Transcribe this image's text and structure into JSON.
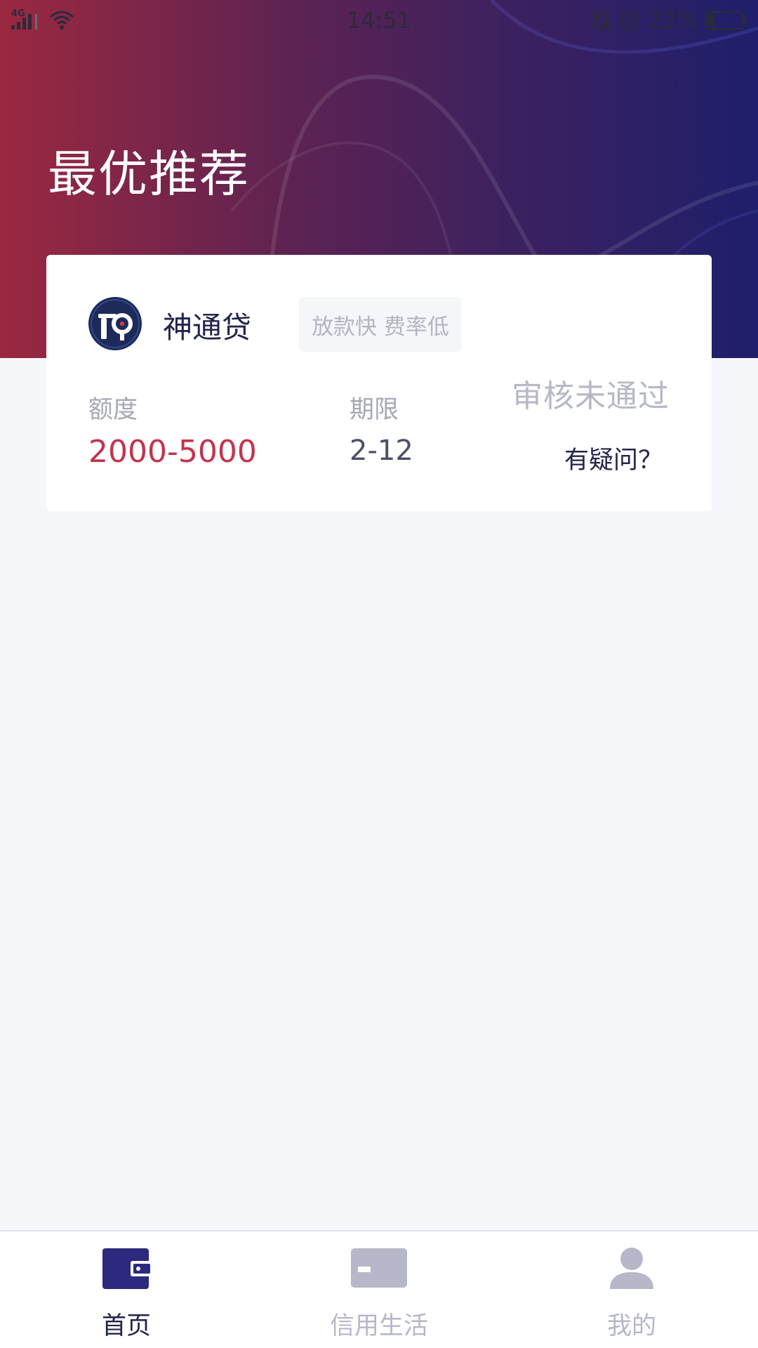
{
  "status_bar": {
    "network_type": "4G",
    "time": "14:51",
    "battery_percent": "22%",
    "battery_level": 0.22
  },
  "page": {
    "title": "最优推荐"
  },
  "card": {
    "product_name": "神通贷",
    "tag": "放款快 费率低",
    "status": "审核未通过",
    "amount_label": "额度",
    "amount_value": "2000-5000",
    "term_label": "期限",
    "term_value": "2-12",
    "question_link": "有疑问？"
  },
  "colors": {
    "accent_red": "#c2344e",
    "brand_navy": "#2b2a7e",
    "tab_inactive": "#b6b8c9"
  },
  "tabs": [
    {
      "label": "首页",
      "icon": "wallet-icon",
      "active": true
    },
    {
      "label": "信用生活",
      "icon": "card-icon",
      "active": false
    },
    {
      "label": "我的",
      "icon": "user-icon",
      "active": false
    }
  ]
}
